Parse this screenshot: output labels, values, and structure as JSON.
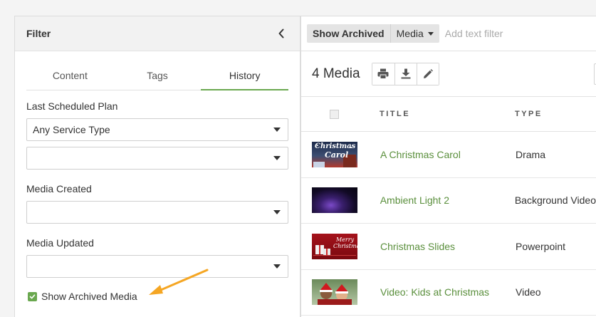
{
  "filter": {
    "title": "Filter",
    "tabs": [
      {
        "label": "Content",
        "active": false
      },
      {
        "label": "Tags",
        "active": false
      },
      {
        "label": "History",
        "active": true
      }
    ],
    "last_scheduled_plan": {
      "label": "Last Scheduled Plan",
      "service_type": "Any Service Type",
      "second_value": ""
    },
    "media_created": {
      "label": "Media Created",
      "value": ""
    },
    "media_updated": {
      "label": "Media Updated",
      "value": ""
    },
    "show_archived": {
      "label": "Show Archived Media",
      "checked": true
    }
  },
  "filter_bar": {
    "show_archived_chip": "Show Archived",
    "media_chip": "Media",
    "text_filter_placeholder": "Add text filter"
  },
  "toolbar": {
    "count": "4 Media",
    "icons": [
      "print-icon",
      "download-icon",
      "pencil-icon"
    ]
  },
  "table": {
    "headers": {
      "title": "TITLE",
      "type": "TYPE"
    },
    "rows": [
      {
        "title": "A Christmas Carol",
        "type": "Drama",
        "thumb": "christmas-carol",
        "thumb_text": [
          "Christmas",
          "Carol"
        ]
      },
      {
        "title": "Ambient Light 2",
        "type": "Background Video",
        "thumb": "ambient-light"
      },
      {
        "title": "Christmas Slides",
        "type": "Powerpoint",
        "thumb": "christmas-slides",
        "thumb_text": [
          "Merry",
          "Christmas"
        ]
      },
      {
        "title": "Video: Kids at Christmas",
        "type": "Video",
        "thumb": "kids-christmas"
      }
    ]
  },
  "colors": {
    "accent_green": "#6aa84f",
    "link_green": "#5a8f3c",
    "arrow_orange": "#f5a623"
  }
}
